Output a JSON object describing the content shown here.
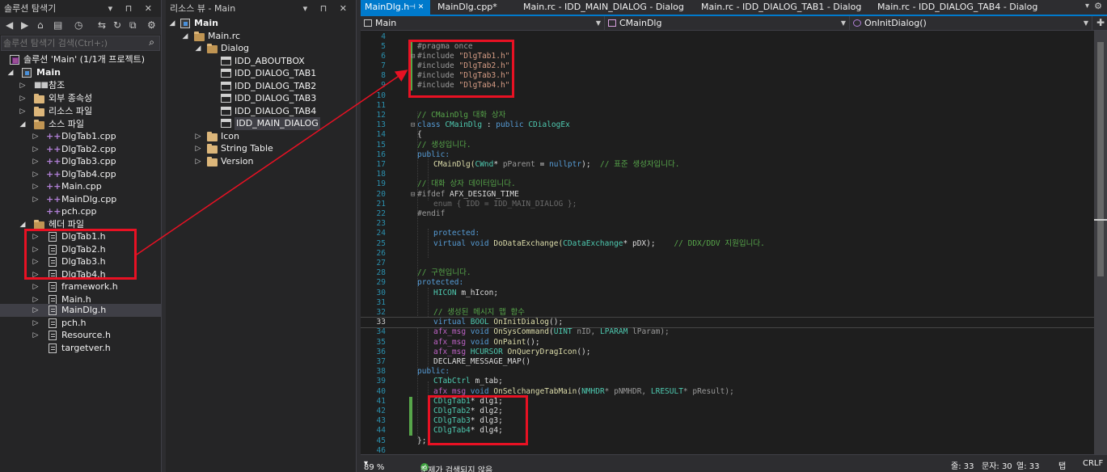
{
  "solution_explorer": {
    "title": "솔루션 탐색기",
    "pins": "▾ ⊓ ✕",
    "search_placeholder": "솔루션 탐색기 검색(Ctrl+;)",
    "root": "솔루션 'Main' (1/1개 프로젝트)",
    "project": "Main",
    "items": {
      "ref": "참조",
      "deps": "외부 종속성",
      "resfiles": "리소스 파일",
      "srcfolder": "소스 파일",
      "src1": "DlgTab1.cpp",
      "src2": "DlgTab2.cpp",
      "src3": "DlgTab3.cpp",
      "src4": "DlgTab4.cpp",
      "src5": "Main.cpp",
      "src6": "MainDlg.cpp",
      "src7": "pch.cpp",
      "hdrfolder": "헤더 파일",
      "h1": "DlgTab1.h",
      "h2": "DlgTab2.h",
      "h3": "DlgTab3.h",
      "h4": "DlgTab4.h",
      "h5": "framework.h",
      "h6": "Main.h",
      "h7": "MainDlg.h",
      "h8": "pch.h",
      "h9": "Resource.h",
      "h10": "targetver.h"
    }
  },
  "resource_view": {
    "title": "리소스 뷰 - Main",
    "pins": "▾ ⊓ ✕",
    "root": "Main",
    "rc": "Main.rc",
    "dialog": "Dialog",
    "dlg1": "IDD_ABOUTBOX",
    "dlg2": "IDD_DIALOG_TAB1",
    "dlg3": "IDD_DIALOG_TAB2",
    "dlg4": "IDD_DIALOG_TAB3",
    "dlg5": "IDD_DIALOG_TAB4",
    "dlg6": "IDD_MAIN_DIALOG",
    "icon": "Icon",
    "string": "String Table",
    "version": "Version"
  },
  "editor": {
    "tabs": {
      "t1": "MainDlg.h",
      "t1_pin": "⊣ ✕",
      "t2": "MainDlg.cpp*",
      "t3": "Main.rc - IDD_MAIN_DIALOG - Dialog",
      "t4": "Main.rc - IDD_DIALOG_TAB1 - Dialog",
      "t5": "Main.rc - IDD_DIALOG_TAB4 - Dialog"
    },
    "nav": {
      "project": "Main",
      "class": "CMainDlg",
      "member": "OnInitDialog()"
    },
    "status": {
      "zoom": "89 %",
      "issues": "문제가 검색되지 않음",
      "line": "줄: 33",
      "char": "문자: 30",
      "col": "열: 33",
      "tab": "탭",
      "eol": "CRLF"
    }
  },
  "code_lines": {
    "n4": "4",
    "n5": "5",
    "n6": "6",
    "n7": "7",
    "n8": "8",
    "n9": "9",
    "n10": "10",
    "n11": "11",
    "n12": "12",
    "n13": "13",
    "n14": "14",
    "n15": "15",
    "n16": "16",
    "n17": "17",
    "n18": "18",
    "n19": "19",
    "n20": "20",
    "n21": "21",
    "n22": "22",
    "n23": "23",
    "n24": "24",
    "n25": "25",
    "n26": "26",
    "n27": "27",
    "n28": "28",
    "n29": "29",
    "n30": "30",
    "n31": "31",
    "n32": "32",
    "n33": "33",
    "n34": "34",
    "n35": "35",
    "n36": "36",
    "n37": "37",
    "n38": "38",
    "n39": "39",
    "n40": "40",
    "n41": "41",
    "n42": "42",
    "n43": "43",
    "n44": "44",
    "n45": "45",
    "n46": "46",
    "l5": "#pragma once",
    "l6a": "#include ",
    "l6b": "\"DlgTab1.h\"",
    "l7a": "#include ",
    "l7b": "\"DlgTab2.h\"",
    "l8a": "#include ",
    "l8b": "\"DlgTab3.h\"",
    "l9a": "#include ",
    "l9b": "\"DlgTab4.h\"",
    "l12": "// CMainDlg 대화 상자",
    "l13a": "class ",
    "l13b": "CMainDlg",
    "l13c": " : ",
    "l13d": "public ",
    "l13e": "CDialogEx",
    "l14": "{",
    "l15": "// 생성입니다.",
    "l16": "public:",
    "l17a": "CMainDlg(",
    "l17b": "CWnd",
    "l17c": "* ",
    "l17d": "pParent",
    "l17e": " = ",
    "l17f": "nullptr",
    "l17g": ");  ",
    "l17h": "// 표준 생성자입니다.",
    "l19": "// 대화 상자 데이터입니다.",
    "l20a": "#ifdef ",
    "l20b": "AFX_DESIGN_TIME",
    "l21a": "enum ",
    "l21b": "{ IDD = IDD_MAIN_DIALOG };",
    "l22": "#endif",
    "l24": "protected:",
    "l25a": "virtual ",
    "l25b": "void ",
    "l25c": "DoDataExchange(",
    "l25d": "CDataExchange",
    "l25e": "* pDX);    ",
    "l25f": "// DDX/DDV 지원입니다.",
    "l28": "// 구현입니다.",
    "l29": "protected:",
    "l30a": "HICON ",
    "l30b": "m_hIcon;",
    "l32": "// 생성된 메시지 맵 함수",
    "l33a": "virtual ",
    "l33b": "BOOL ",
    "l33c": "OnInitDialog",
    "l33d": "();",
    "l34a": "afx_msg ",
    "l34b": "void ",
    "l34c": "OnSysCommand",
    "l34d": "(",
    "l34e": "UINT ",
    "l34f": "nID, ",
    "l34g": "LPARAM ",
    "l34h": "lParam);",
    "l35a": "afx_msg ",
    "l35b": "void ",
    "l35c": "OnPaint",
    "l35d": "();",
    "l36a": "afx_msg ",
    "l36b": "HCURSOR ",
    "l36c": "OnQueryDragIcon",
    "l36d": "();",
    "l37": "DECLARE_MESSAGE_MAP()",
    "l38": "public:",
    "l39a": "CTabCtrl ",
    "l39b": "m_tab;",
    "l40a": "afx_msg ",
    "l40b": "void ",
    "l40c": "OnSelchangeTabMain",
    "l40d": "(",
    "l40e": "NMHDR",
    "l40f": "* pNMHDR, ",
    "l40g": "LRESULT",
    "l40h": "* pResult);",
    "l41a": "CDlgTab1",
    "l41b": "* dlg1;",
    "l42a": "CDlgTab2",
    "l42b": "* dlg2;",
    "l43a": "CDlgTab3",
    "l43b": "* dlg3;",
    "l44a": "CDlgTab4",
    "l44b": "* dlg4;",
    "l45": "};"
  },
  "colors": {
    "accent": "#007acc",
    "highlight": "#e81123",
    "background": "#1e1e1e"
  }
}
